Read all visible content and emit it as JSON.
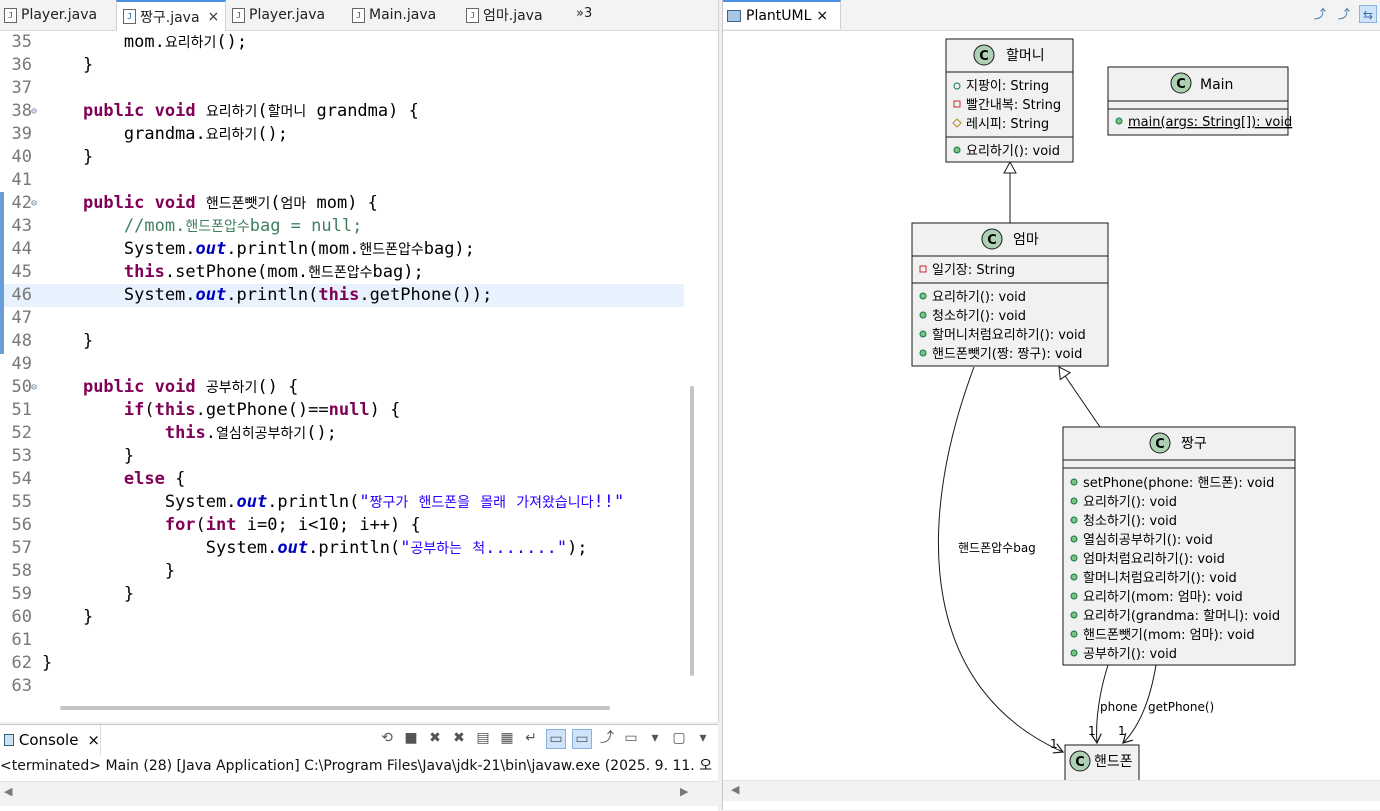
{
  "editor": {
    "tabs": [
      {
        "label": "Player.java"
      },
      {
        "label": "짱구.java",
        "close": "×"
      },
      {
        "label": "Player.java"
      },
      {
        "label": "Main.java"
      },
      {
        "label": "엄마.java"
      }
    ],
    "overflow_label": "»3",
    "highlighted_line": 46
  },
  "code_lines": [
    {
      "n": "35",
      "t": "        mom.요리하기();"
    },
    {
      "n": "36",
      "t": "    }"
    },
    {
      "n": "37",
      "t": ""
    },
    {
      "n": "38",
      "t": "    public void 요리하기(할머니 grandma) {"
    },
    {
      "n": "39",
      "t": "        grandma.요리하기();"
    },
    {
      "n": "40",
      "t": "    }"
    },
    {
      "n": "41",
      "t": ""
    },
    {
      "n": "42",
      "t": "    public void 핸드폰뺏기(엄마 mom) {"
    },
    {
      "n": "43",
      "t": "        //mom.핸드폰압수bag = null;"
    },
    {
      "n": "44",
      "t": "        System.out.println(mom.핸드폰압수bag);"
    },
    {
      "n": "45",
      "t": "        this.setPhone(mom.핸드폰압수bag);"
    },
    {
      "n": "46",
      "t": "        System.out.println(this.getPhone());"
    },
    {
      "n": "47",
      "t": ""
    },
    {
      "n": "48",
      "t": "    }"
    },
    {
      "n": "49",
      "t": ""
    },
    {
      "n": "50",
      "t": "    public void 공부하기() {"
    },
    {
      "n": "51",
      "t": "        if(this.getPhone()==null) {"
    },
    {
      "n": "52",
      "t": "            this.열심히공부하기();"
    },
    {
      "n": "53",
      "t": "        }"
    },
    {
      "n": "54",
      "t": "        else {"
    },
    {
      "n": "55",
      "t": "            System.out.println(\"짱구가 핸드폰을 몰래 가져왔습니다!!\""
    },
    {
      "n": "56",
      "t": "            for(int i=0; i<10; i++) {"
    },
    {
      "n": "57",
      "t": "                System.out.println(\"공부하는 척.......\");"
    },
    {
      "n": "58",
      "t": "            }"
    },
    {
      "n": "59",
      "t": "        }"
    },
    {
      "n": "60",
      "t": "    }"
    },
    {
      "n": "61",
      "t": ""
    },
    {
      "n": "62",
      "t": "}"
    },
    {
      "n": "63",
      "t": ""
    }
  ],
  "console": {
    "tab_label": "Console",
    "close": "×",
    "status": "<terminated> Main (28) [Java Application] C:\\Program Files\\Java\\jdk-21\\bin\\javaw.exe  (2025. 9. 11. 오"
  },
  "plantuml": {
    "tab_label": "PlantUML",
    "close": "×",
    "classes": {
      "grandma": {
        "name": "할머니",
        "fields": [
          {
            "vis": "public",
            "text": "지팡이: String"
          },
          {
            "vis": "private",
            "text": "빨간내복: String"
          },
          {
            "vis": "protected",
            "text": "레시피: String"
          }
        ],
        "methods": [
          {
            "vis": "public",
            "text": "요리하기(): void"
          }
        ]
      },
      "main": {
        "name": "Main",
        "methods": [
          {
            "vis": "public",
            "text": "main(args: String[]): void"
          }
        ]
      },
      "mom": {
        "name": "엄마",
        "fields": [
          {
            "vis": "private",
            "text": "일기장: String"
          }
        ],
        "methods": [
          {
            "vis": "public",
            "text": "요리하기(): void"
          },
          {
            "vis": "public",
            "text": "청소하기(): void"
          },
          {
            "vis": "public",
            "text": "할머니처럼요리하기(): void"
          },
          {
            "vis": "public",
            "text": "핸드폰뺏기(짱: 짱구): void"
          }
        ]
      },
      "jjanggu": {
        "name": "짱구",
        "methods": [
          {
            "vis": "public",
            "text": "setPhone(phone: 핸드폰): void"
          },
          {
            "vis": "public",
            "text": "요리하기(): void"
          },
          {
            "vis": "public",
            "text": "청소하기(): void"
          },
          {
            "vis": "public",
            "text": "열심히공부하기(): void"
          },
          {
            "vis": "public",
            "text": "엄마처럼요리하기(): void"
          },
          {
            "vis": "public",
            "text": "할머니처럼요리하기(): void"
          },
          {
            "vis": "public",
            "text": "요리하기(mom: 엄마): void"
          },
          {
            "vis": "public",
            "text": "요리하기(grandma: 할머니): void"
          },
          {
            "vis": "public",
            "text": "핸드폰뺏기(mom: 엄마): void"
          },
          {
            "vis": "public",
            "text": "공부하기(): void"
          }
        ]
      },
      "phone": {
        "name": "핸드폰"
      }
    },
    "class_marker": "C",
    "edge_labels": {
      "bag": "핸드폰압수bag",
      "phone": "phone",
      "getphone": "getPhone()",
      "mult_1": "1"
    },
    "colors": {
      "class_bg": "#f1f1f1",
      "circle": "#add1b2",
      "border": "#181818"
    }
  }
}
